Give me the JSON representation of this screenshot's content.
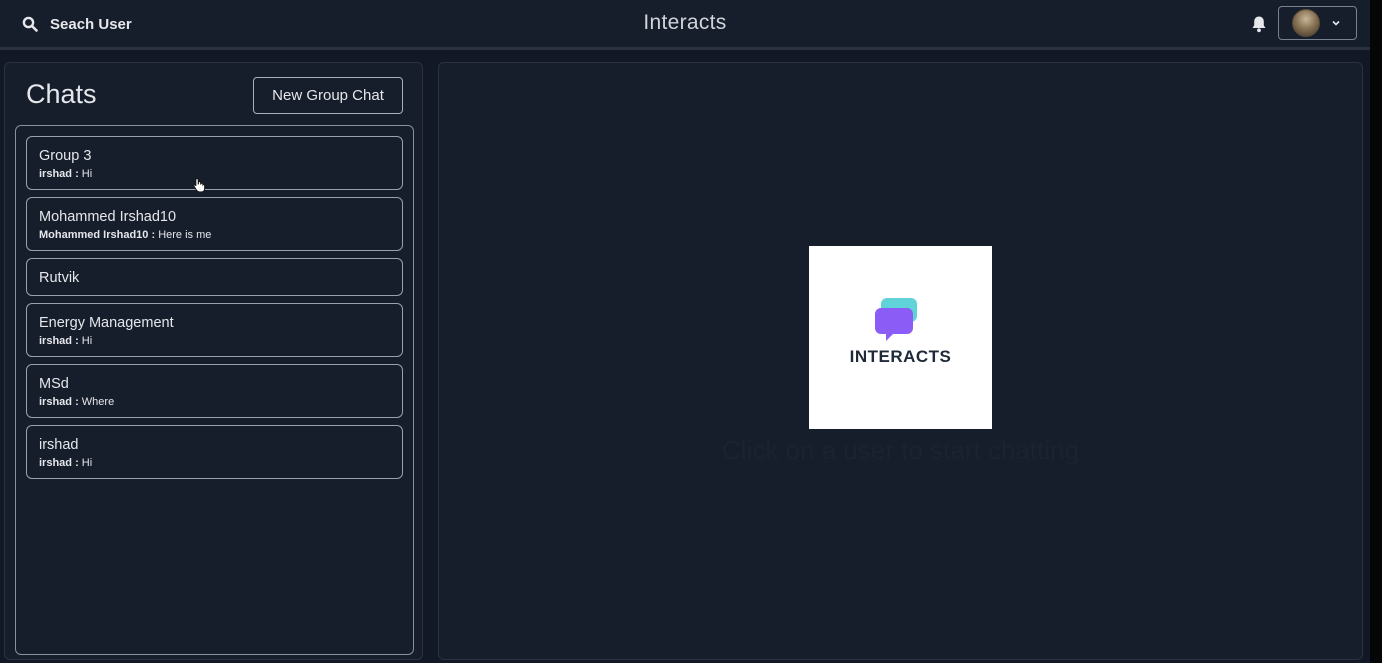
{
  "header": {
    "search_label": "Seach User",
    "app_title": "Interacts",
    "search_icon": "search-icon",
    "notification_icon": "bell-icon",
    "profile_dropdown_icon": "chevron-down-icon"
  },
  "sidebar": {
    "title": "Chats",
    "new_group_label": "New Group Chat",
    "chats": [
      {
        "name": "Group 3",
        "sender": "irshad :",
        "message": "Hi"
      },
      {
        "name": "Mohammed Irshad10",
        "sender": "Mohammed Irshad10 :",
        "message": "Here is me"
      },
      {
        "name": "Rutvik",
        "sender": "",
        "message": ""
      },
      {
        "name": "Energy Management",
        "sender": "irshad :",
        "message": "Hi"
      },
      {
        "name": "MSd",
        "sender": "irshad :",
        "message": "Where"
      },
      {
        "name": "irshad",
        "sender": "irshad :",
        "message": "Hi"
      }
    ]
  },
  "main": {
    "logo_text": "INTERACTS",
    "empty_message": "Click on a user to start chatting"
  },
  "colors": {
    "background": "#121826",
    "panel": "#161d2b",
    "logo_bubble_front": "#8b5cf6",
    "logo_bubble_back": "#5fd3d8"
  }
}
